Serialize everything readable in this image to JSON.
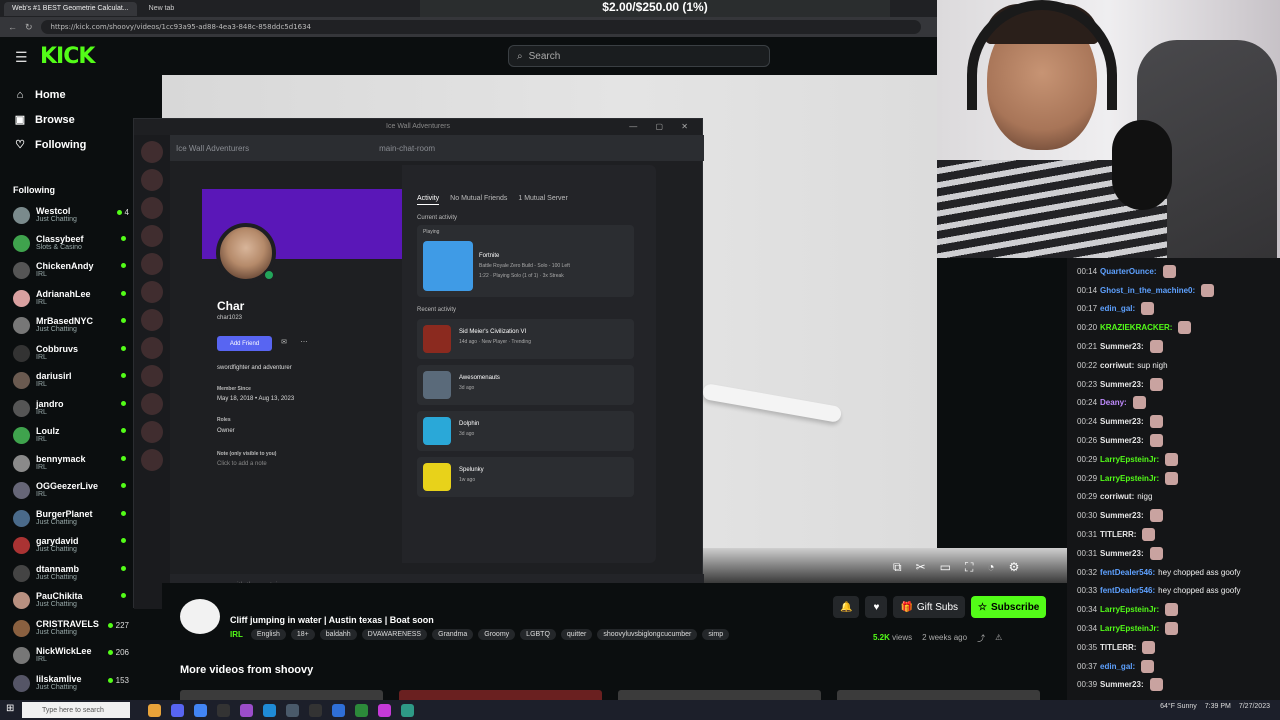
{
  "browser": {
    "tabs": [
      {
        "label": "Web's #1 BEST Geometrie Calculat..."
      },
      {
        "label": "New tab"
      }
    ],
    "url": "https://kick.com/shoovy/videos/1cc93a95-ad88-4ea3-848c-858ddc5d1634"
  },
  "overlay": {
    "price": "$2.00/$250.00 (1%)"
  },
  "header": {
    "logo": "KICK",
    "search_placeholder": "Search"
  },
  "sidebar": {
    "nav": [
      {
        "label": "Home",
        "icon": "home-icon"
      },
      {
        "label": "Browse",
        "icon": "browse-icon"
      },
      {
        "label": "Following",
        "icon": "heart-icon"
      }
    ],
    "following_title": "Following",
    "items": [
      {
        "name": "Westcol",
        "category": "Just Chatting",
        "count": "4",
        "color": "#7a8a8c"
      },
      {
        "name": "Classybeef",
        "category": "Slots & Casino",
        "count": "",
        "color": "#3fa34d"
      },
      {
        "name": "ChickenAndy",
        "category": "IRL",
        "count": "",
        "color": "#555"
      },
      {
        "name": "AdrianahLee",
        "category": "IRL",
        "count": "",
        "color": "#d9a0a0"
      },
      {
        "name": "MrBasedNYC",
        "category": "Just Chatting",
        "count": "",
        "color": "#777"
      },
      {
        "name": "Cobbruvs",
        "category": "IRL",
        "count": "",
        "color": "#333"
      },
      {
        "name": "dariusirl",
        "category": "IRL",
        "count": "",
        "color": "#6a5a50"
      },
      {
        "name": "jandro",
        "category": "IRL",
        "count": "",
        "color": "#555"
      },
      {
        "name": "Loulz",
        "category": "IRL",
        "count": "",
        "color": "#3fa34d"
      },
      {
        "name": "bennymack",
        "category": "IRL",
        "count": "",
        "color": "#8a8a8a"
      },
      {
        "name": "OGGeezerLive",
        "category": "IRL",
        "count": "",
        "color": "#667"
      },
      {
        "name": "BurgerPlanet",
        "category": "Just Chatting",
        "count": "",
        "color": "#4a6a8a"
      },
      {
        "name": "garydavid",
        "category": "Just Chatting",
        "count": "",
        "color": "#a33"
      },
      {
        "name": "dtannamb",
        "category": "Just Chatting",
        "count": "",
        "color": "#444"
      },
      {
        "name": "PauChikita",
        "category": "Just Chatting",
        "count": "",
        "color": "#b89080"
      },
      {
        "name": "CRISTRAVELS",
        "category": "Just Chatting",
        "count": "227",
        "color": "#8a6040"
      },
      {
        "name": "NickWickLee",
        "category": "IRL",
        "count": "206",
        "color": "#777"
      },
      {
        "name": "lilskamlive",
        "category": "Just Chatting",
        "count": "153",
        "color": "#556"
      }
    ]
  },
  "discord": {
    "window_title": "Ice Wall Adventurers",
    "server_name": "Ice Wall Adventurers",
    "channel": "main-chat-room",
    "bottom_channel": "my-messages-with-the-captain",
    "profile": {
      "display_name": "Char",
      "username": "char1023",
      "add_friend": "Add Friend",
      "bio": "swordfighter and adventurer",
      "member_since_label": "Member Since",
      "member_since_discord": "May 18, 2018",
      "member_since_server": "Aug 13, 2023",
      "roles_label": "Roles",
      "role": "Owner",
      "note_label": "Note (only visible to you)",
      "note_placeholder": "Click to add a note",
      "tabs": [
        "Activity",
        "No Mutual Friends",
        "1 Mutual Server"
      ],
      "current_activity": "Current activity",
      "playing": "Playing",
      "current_game": {
        "title": "Fortnite",
        "detail": "Battle Royale Zero Build - Solo - 100 Left",
        "meta": "1:22 · Playing Solo (1 of 1) · 3x Streak"
      },
      "recent_activity": "Recent activity",
      "recent": [
        {
          "title": "Sid Meier's Civilization VI",
          "meta": "14d ago · New Player · Trending",
          "color": "#8b2a1f"
        },
        {
          "title": "Awesomenauts",
          "meta": "3d ago",
          "color": "#5a6a7a"
        },
        {
          "title": "Dolphin",
          "meta": "3d ago",
          "color": "#2aa8d8"
        },
        {
          "title": "Spelunky",
          "meta": "1w ago",
          "color": "#e8d21a"
        }
      ]
    }
  },
  "video": {
    "title": "Cliff jumping in water | Austin texas | Boat soon",
    "category": "IRL",
    "tags": [
      "English",
      "18+",
      "baldahh",
      "DVAWARENESS",
      "Grandma",
      "Groomy",
      "LGBTQ",
      "quitter",
      "shoovyluvsbiglongcucumber",
      "simp"
    ],
    "views": "5.2K",
    "views_label": "views",
    "age": "2 weeks ago",
    "gift_subs": "Gift Subs",
    "subscribe": "Subscribe",
    "more_videos": "More videos from shoovy"
  },
  "chat": {
    "messages": [
      {
        "time": "00:14",
        "user": "QuarterOunce:",
        "msg": "",
        "color": "#5ea1ff"
      },
      {
        "time": "00:14",
        "user": "Ghost_in_the_machine0:",
        "msg": "",
        "color": "#5ea1ff"
      },
      {
        "time": "00:17",
        "user": "edin_gal:",
        "msg": "",
        "color": "#5ea1ff"
      },
      {
        "time": "00:20",
        "user": "KRAZIEKRACKER:",
        "msg": "",
        "color": "#53fc18"
      },
      {
        "time": "00:21",
        "user": "Summer23:",
        "msg": "",
        "color": "#e8e8e8"
      },
      {
        "time": "00:22",
        "user": "corriwut:",
        "msg": "sup nigh",
        "color": "#e8e8e8"
      },
      {
        "time": "00:23",
        "user": "Summer23:",
        "msg": "",
        "color": "#e8e8e8"
      },
      {
        "time": "00:24",
        "user": "Deany:",
        "msg": "",
        "color": "#c08bff"
      },
      {
        "time": "00:24",
        "user": "Summer23:",
        "msg": "",
        "color": "#e8e8e8"
      },
      {
        "time": "00:26",
        "user": "Summer23:",
        "msg": "",
        "color": "#e8e8e8"
      },
      {
        "time": "00:29",
        "user": "LarryEpsteinJr:",
        "msg": "",
        "color": "#53fc18"
      },
      {
        "time": "00:29",
        "user": "LarryEpsteinJr:",
        "msg": "",
        "color": "#53fc18"
      },
      {
        "time": "00:29",
        "user": "corriwut:",
        "msg": "nigg",
        "color": "#e8e8e8"
      },
      {
        "time": "00:30",
        "user": "Summer23:",
        "msg": "",
        "color": "#e8e8e8"
      },
      {
        "time": "00:31",
        "user": "TITLERR:",
        "msg": "",
        "color": "#e8e8e8"
      },
      {
        "time": "00:31",
        "user": "Summer23:",
        "msg": "",
        "color": "#e8e8e8"
      },
      {
        "time": "00:32",
        "user": "fentDealer546:",
        "msg": "hey chopped ass goofy",
        "color": "#5ea1ff"
      },
      {
        "time": "00:33",
        "user": "fentDealer546:",
        "msg": "hey chopped ass goofy",
        "color": "#5ea1ff"
      },
      {
        "time": "00:34",
        "user": "LarryEpsteinJr:",
        "msg": "",
        "color": "#53fc18"
      },
      {
        "time": "00:34",
        "user": "LarryEpsteinJr:",
        "msg": "",
        "color": "#53fc18"
      },
      {
        "time": "00:35",
        "user": "TITLERR:",
        "msg": "",
        "color": "#e8e8e8"
      },
      {
        "time": "00:37",
        "user": "edin_gal:",
        "msg": "",
        "color": "#5ea1ff"
      },
      {
        "time": "00:39",
        "user": "Summer23:",
        "msg": "",
        "color": "#e8e8e8"
      }
    ]
  },
  "taskbar": {
    "search_placeholder": "Type here to search",
    "weather": "64°F Sunny",
    "time": "7:39 PM",
    "date": "7/27/2023"
  }
}
